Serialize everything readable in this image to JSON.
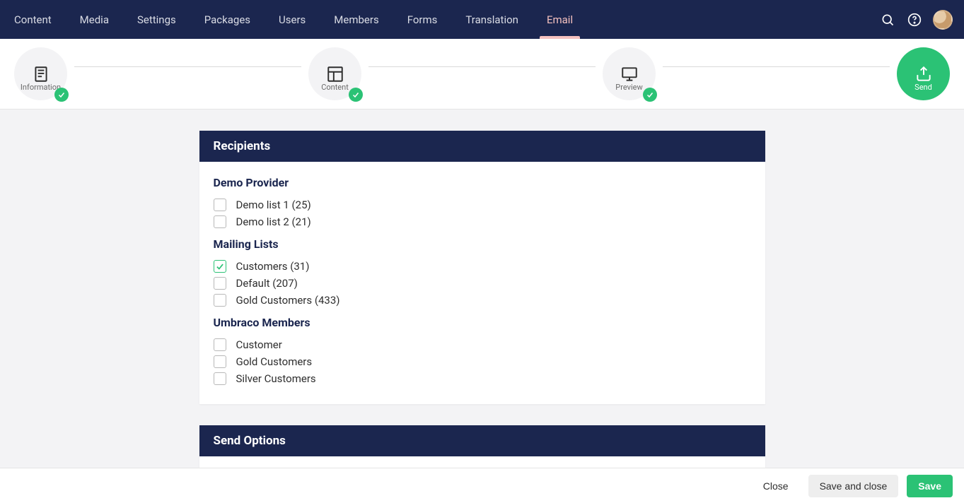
{
  "nav": {
    "items": [
      {
        "label": "Content",
        "active": false
      },
      {
        "label": "Media",
        "active": false
      },
      {
        "label": "Settings",
        "active": false
      },
      {
        "label": "Packages",
        "active": false
      },
      {
        "label": "Users",
        "active": false
      },
      {
        "label": "Members",
        "active": false
      },
      {
        "label": "Forms",
        "active": false
      },
      {
        "label": "Translation",
        "active": false
      },
      {
        "label": "Email",
        "active": true
      }
    ],
    "icons": {
      "search": "search-icon",
      "help": "help-icon",
      "avatar": "user-avatar"
    }
  },
  "stepper": {
    "steps": [
      {
        "label": "Information",
        "icon": "document-icon",
        "done": true,
        "active": false
      },
      {
        "label": "Content",
        "icon": "template-icon",
        "done": true,
        "active": false
      },
      {
        "label": "Preview",
        "icon": "monitor-icon",
        "done": true,
        "active": false
      },
      {
        "label": "Send",
        "icon": "outbox-icon",
        "done": false,
        "active": true
      }
    ]
  },
  "panels": {
    "recipients": {
      "title": "Recipients",
      "groups": [
        {
          "title": "Demo Provider",
          "items": [
            {
              "label": "Demo list 1 (25)",
              "checked": false
            },
            {
              "label": "Demo list 2 (21)",
              "checked": false
            }
          ]
        },
        {
          "title": "Mailing Lists",
          "items": [
            {
              "label": "Customers (31)",
              "checked": true
            },
            {
              "label": "Default (207)",
              "checked": false
            },
            {
              "label": "Gold Customers (433)",
              "checked": false
            }
          ]
        },
        {
          "title": "Umbraco Members",
          "items": [
            {
              "label": "Customer",
              "checked": false
            },
            {
              "label": "Gold Customers",
              "checked": false
            },
            {
              "label": "Silver Customers",
              "checked": false
            }
          ]
        }
      ]
    },
    "sendOptions": {
      "title": "Send Options"
    }
  },
  "footer": {
    "close": "Close",
    "saveAndClose": "Save and close",
    "save": "Save"
  },
  "colors": {
    "navy": "#1b264f",
    "green": "#2bc275",
    "accentPink": "#f5c1bf"
  }
}
